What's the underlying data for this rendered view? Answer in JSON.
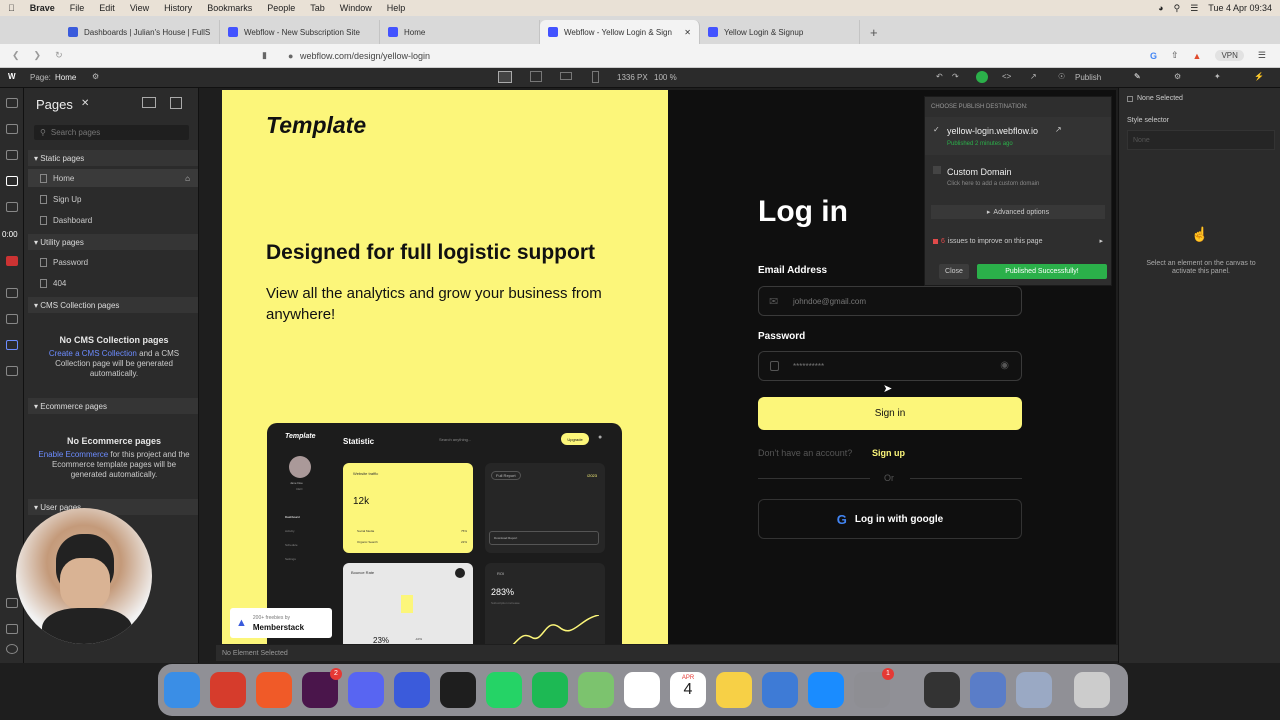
{
  "menubar": {
    "app": "Brave",
    "items": [
      "File",
      "Edit",
      "View",
      "History",
      "Bookmarks",
      "People",
      "Tab",
      "Window",
      "Help"
    ],
    "datetime": "Tue 4 Apr 09:34"
  },
  "tabs": [
    {
      "label": "Dashboards | Julian's House | FullS"
    },
    {
      "label": "Webflow - New Subscription Site"
    },
    {
      "label": "Home"
    },
    {
      "label": "Webflow - Yellow Login & Sign"
    },
    {
      "label": "Yellow Login & Signup"
    }
  ],
  "address": {
    "url": "webflow.com/design/yellow-login",
    "vpn": "VPN"
  },
  "wf_top": {
    "page_label": "Page:",
    "page_name": "Home",
    "width": "1336 PX",
    "zoom": "100 %",
    "publish": "Publish"
  },
  "pages_panel": {
    "title": "Pages",
    "search_placeholder": "Search pages",
    "static_header": "Static pages",
    "static_items": [
      "Home",
      "Sign Up",
      "Dashboard"
    ],
    "utility_header": "Utility pages",
    "utility_items": [
      "Password",
      "404"
    ],
    "cms_header": "CMS Collection pages",
    "cms_empty_title": "No CMS Collection pages",
    "cms_empty_link": "Create a CMS Collection",
    "cms_empty_text": "and a CMS Collection page will be generated automatically.",
    "ecom_header": "Ecommerce pages",
    "ecom_empty_title": "No Ecommerce pages",
    "ecom_empty_link": "Enable Ecommerce",
    "ecom_empty_text": "for this project and the Ecommerce template pages will be generated automatically.",
    "user_header": "User pages",
    "timer": "0:00"
  },
  "site": {
    "logo": "Template",
    "headline": "Designed for full logistic support",
    "subhead": "View all the analytics and grow your business from anywhere!",
    "login_title": "Log in",
    "email_label": "Email Address",
    "email_value": "johndoe@gmail.com",
    "password_label": "Password",
    "password_value": "**********",
    "signin_button": "Sign in",
    "no_account": "Don't have an account?",
    "signup_link": "Sign up",
    "or": "Or",
    "google_button": "Log in with google",
    "badge_top": "200+ freebies by",
    "badge_bottom": "Memberstack"
  },
  "mock": {
    "logo": "Template",
    "title": "Statistic",
    "search": "Search anything...",
    "upgrade": "Upgrade",
    "user_name": "Jane Doe",
    "user_sub": "CEO",
    "nav": [
      "Dashboard",
      "Activity",
      "Schedule",
      "Settings"
    ],
    "card1_title": "Website traffic",
    "card1_value": "12k",
    "card1_rows": [
      "Social Media",
      "Organic Search"
    ],
    "card1_pcts": [
      "75%",
      "22%"
    ],
    "full_report": "Full Report",
    "full_report_year": "/2023",
    "download": "Download Report",
    "bounce_title": "Bounce Rate",
    "bounce_value": "23%",
    "bounce_pct": "-10%",
    "roi_title": "ROI",
    "roi_value": "283%",
    "roi_sub": "Subscription increase"
  },
  "publish_popover": {
    "heading": "CHOOSE PUBLISH DESTINATION:",
    "domain1": "yellow-login.webflow.io",
    "domain1_status": "Published 2 minutes ago",
    "domain2": "Custom Domain",
    "domain2_sub": "Click here to add a custom domain",
    "advanced": "Advanced options",
    "issues_count": "6",
    "issues_text": "issues to improve on this page",
    "close": "Close",
    "success": "Published Successfully!"
  },
  "style_panel": {
    "none_selected": "None Selected",
    "selector_label": "Style selector",
    "selector_value": "None",
    "hint": "Select an element on the canvas to activate this panel."
  },
  "status_bar": {
    "text": "No Element Selected"
  },
  "dock_badges": {
    "slack": "2",
    "settings": "1",
    "calendar_day": "4",
    "calendar_month": "APR"
  },
  "colors": {
    "accent_yellow": "#fcf67a",
    "publish_green": "#2bb04a",
    "webflow_blue": "#4353ff"
  }
}
